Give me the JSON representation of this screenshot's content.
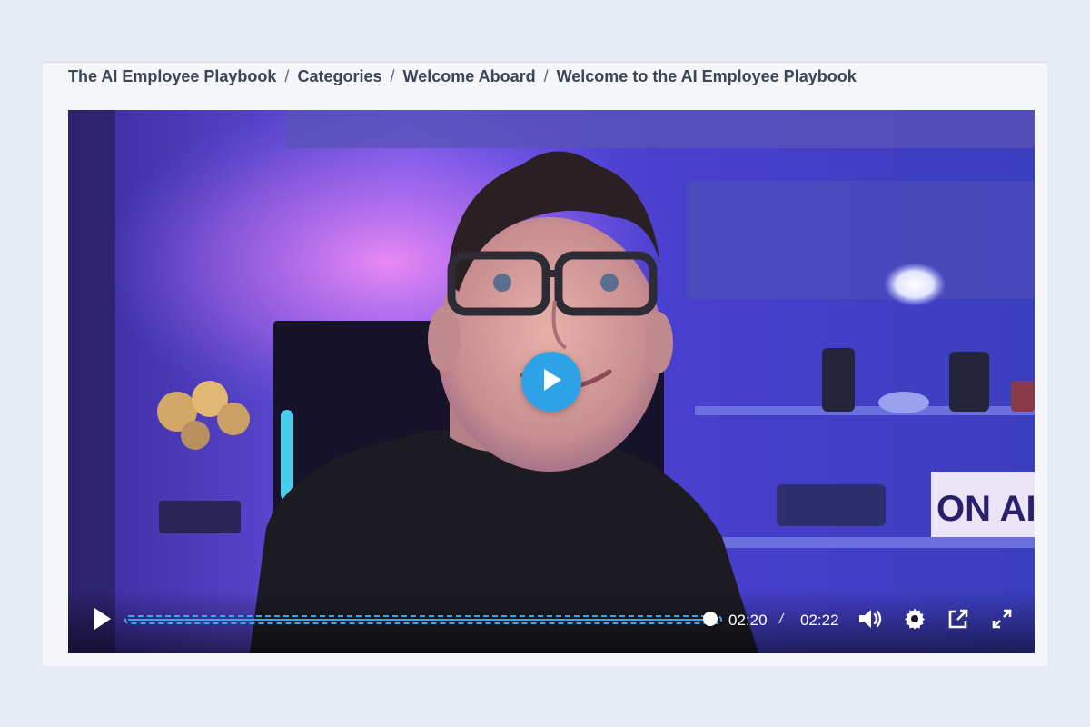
{
  "breadcrumb": {
    "items": [
      "The AI Employee Playbook",
      "Categories",
      "Welcome Aboard",
      "Welcome to the AI Employee Playbook"
    ],
    "separator": "/"
  },
  "player": {
    "current_time": "02:20",
    "duration": "02:22",
    "time_separator": "/",
    "progress_fraction": 0.986,
    "accent_color": "#2ea2e6",
    "icons": {
      "big_play": "play-icon",
      "play": "play-icon",
      "volume": "volume-icon",
      "settings": "gear-icon",
      "popout": "external-link-icon",
      "fullscreen": "fullscreen-icon"
    }
  },
  "scene": {
    "sign_text": "ON AI"
  }
}
